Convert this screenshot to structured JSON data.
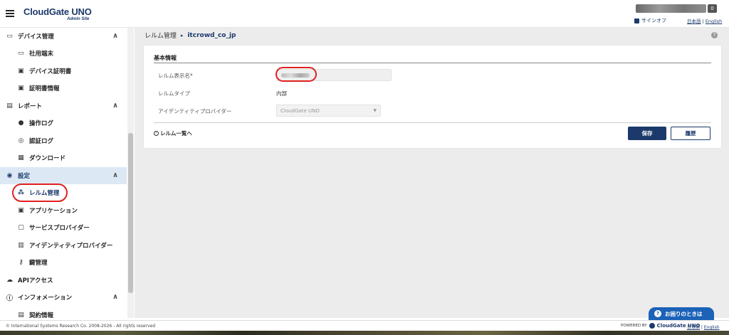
{
  "header": {
    "logo": "CloudGate UNO",
    "logo_sub": "Admin Site",
    "count": "0",
    "signout": "サインオフ",
    "lang_ja": "日本語",
    "lang_sep": " | ",
    "lang_en": "English"
  },
  "sidebar": {
    "items": [
      {
        "label": "デバイス管理",
        "icon": "device-icon",
        "type": "section",
        "chevron": "∧"
      },
      {
        "label": "社用端末",
        "icon": "computer-icon",
        "type": "sub"
      },
      {
        "label": "デバイス証明書",
        "icon": "certificate-card-icon",
        "type": "sub"
      },
      {
        "label": "証明書情報",
        "icon": "certificate-info-icon",
        "type": "sub"
      },
      {
        "label": "レポート",
        "icon": "report-icon",
        "type": "section",
        "chevron": "∧"
      },
      {
        "label": "操作ログ",
        "icon": "clock-icon",
        "type": "sub"
      },
      {
        "label": "認証ログ",
        "icon": "fingerprint-icon",
        "type": "sub"
      },
      {
        "label": "ダウンロード",
        "icon": "download-icon",
        "type": "sub"
      },
      {
        "label": "設定",
        "icon": "settings-icon",
        "type": "section",
        "chevron": "∧",
        "active": true
      },
      {
        "label": "レルム管理",
        "icon": "hierarchy-icon",
        "type": "sub",
        "active": true
      },
      {
        "label": "アプリケーション",
        "icon": "application-icon",
        "type": "sub"
      },
      {
        "label": "サービスプロバイダー",
        "icon": "link-icon",
        "type": "sub"
      },
      {
        "label": "アイデンティティプロバイダー",
        "icon": "building-icon",
        "type": "sub"
      },
      {
        "label": "鍵管理",
        "icon": "key-icon",
        "type": "sub"
      },
      {
        "label": "APIアクセス",
        "icon": "cloud-gear-icon",
        "type": "section"
      },
      {
        "label": "インフォメーション",
        "icon": "info-icon",
        "type": "section",
        "chevron": "∧"
      },
      {
        "label": "契約情報",
        "icon": "contract-icon",
        "type": "sub"
      }
    ]
  },
  "breadcrumb": {
    "parent": "レルム管理",
    "arrow": "▸",
    "current": "itcrowd_co_jp"
  },
  "help_icon": "?",
  "card": {
    "title": "基本情報",
    "fields": {
      "display_name_label": "レルム表示名*",
      "type_label": "レルムタイプ",
      "type_value": "内部",
      "idp_label": "アイデンティティプロバイダー",
      "idp_value": "CloudGate UNO"
    },
    "back_link": "レルム一覧へ",
    "save_button": "保存",
    "history_button": "履歴"
  },
  "footer": {
    "copyright": "© International Systems Research Co.  2008-2026 - All rights reserved",
    "powered_by": "POWERED BY",
    "powered_brand": "CloudGate UNO",
    "lang_ja": "日本語",
    "lang_en": "English"
  },
  "help_button": "お困りのときは",
  "colors": {
    "accent": "#1b3a6b",
    "highlight": "#e02020",
    "help": "#1b62b8"
  }
}
